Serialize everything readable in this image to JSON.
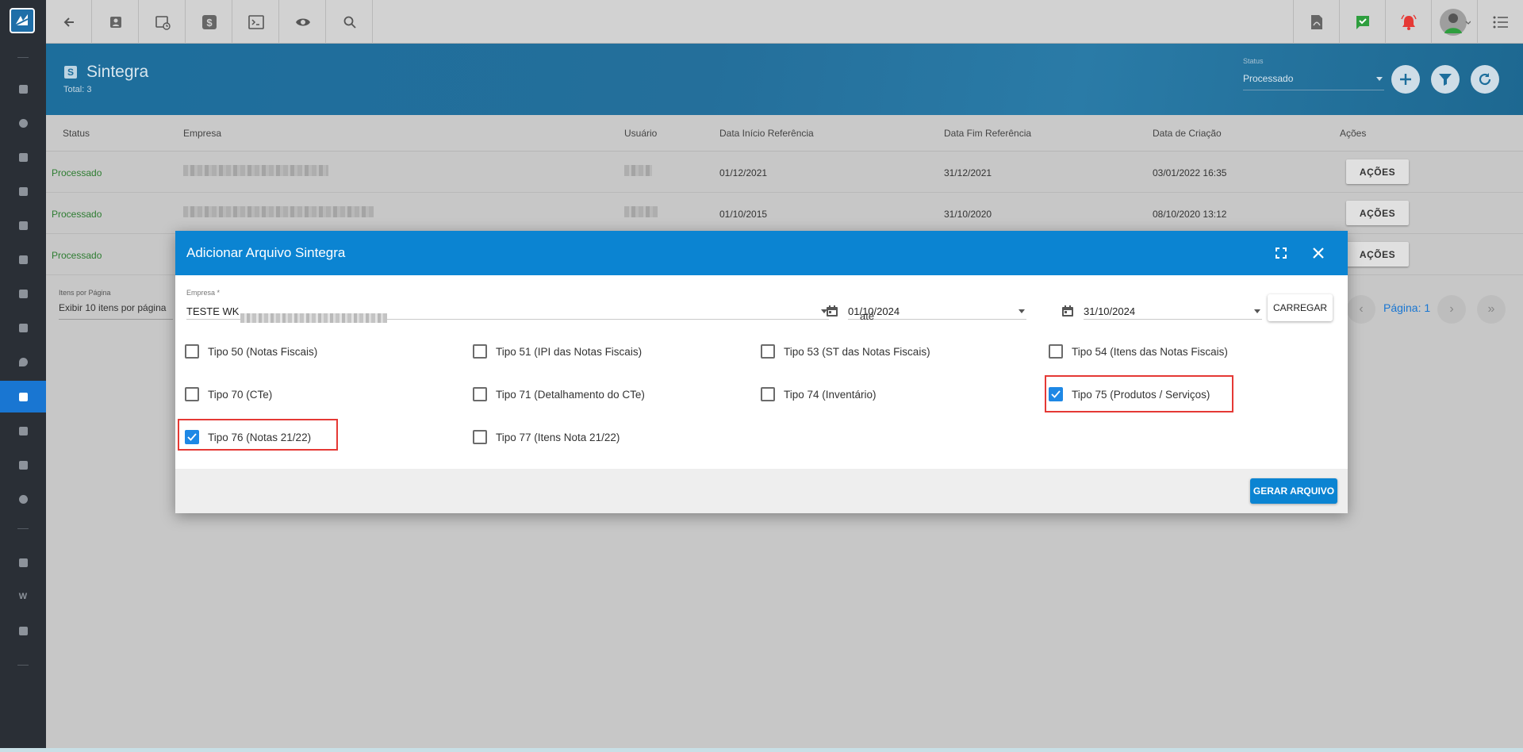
{
  "header": {
    "title": "Sintegra",
    "total": "Total: 3",
    "status_label": "Status",
    "status_value": "Processado"
  },
  "table": {
    "columns": [
      "Status",
      "Empresa",
      "Usuário",
      "Data Início Referência",
      "Data Fim Referência",
      "Data de Criação",
      "Ações"
    ],
    "rows": [
      {
        "status": "Processado",
        "inicio": "01/12/2021",
        "fim": "31/12/2021",
        "criacao": "03/01/2022 16:35",
        "acoes": "AÇÕES"
      },
      {
        "status": "Processado",
        "inicio": "01/10/2015",
        "fim": "31/10/2020",
        "criacao": "08/10/2020 13:12",
        "acoes": "AÇÕES"
      },
      {
        "status": "Processado",
        "inicio": "",
        "fim": "",
        "criacao": "",
        "acoes": "AÇÕES"
      }
    ]
  },
  "pager": {
    "label": "Itens por Página",
    "value": "Exibir 10 itens por página",
    "page": "Página: 1"
  },
  "modal": {
    "title": "Adicionar Arquivo Sintegra",
    "empresa_label": "Empresa *",
    "empresa_value": "TESTE WK",
    "data_inicio": "01/10/2024",
    "ate": "até",
    "data_fim": "31/10/2024",
    "carregar": "CARREGAR",
    "gerar": "GERAR ARQUIVO",
    "checkboxes": [
      {
        "label": "Tipo 50 (Notas Fiscais)",
        "checked": false
      },
      {
        "label": "Tipo 51 (IPI das Notas Fiscais)",
        "checked": false
      },
      {
        "label": "Tipo 53 (ST das Notas Fiscais)",
        "checked": false
      },
      {
        "label": "Tipo 54 (Itens das Notas Fiscais)",
        "checked": false
      },
      {
        "label": "Tipo 70 (CTe)",
        "checked": false
      },
      {
        "label": "Tipo 71 (Detalhamento do CTe)",
        "checked": false
      },
      {
        "label": "Tipo 74 (Inventário)",
        "checked": false
      },
      {
        "label": "Tipo 75 (Produtos / Serviços)",
        "checked": true
      },
      {
        "label": "Tipo 76 (Notas 21/22)",
        "checked": true
      },
      {
        "label": "Tipo 77 (Itens Nota 21/22)",
        "checked": false
      }
    ]
  },
  "colors": {
    "accent": "#0b84d2",
    "header": "#1d6e9c",
    "highlight": "#e53935",
    "status_green": "#2e7d32"
  }
}
